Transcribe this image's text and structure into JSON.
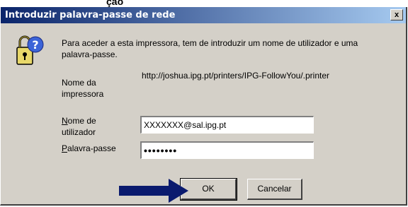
{
  "top_fragment": "ção",
  "window": {
    "title": "Introduzir palavra-passe de rede",
    "close_glyph": "x"
  },
  "message": "Para aceder a esta impressora, tem de introduzir um nome de utilizador e uma palavra-passe.",
  "printer": {
    "label": "Nome da impressora",
    "value": "http://joshua.ipg.pt/printers/IPG-FollowYou/.printer"
  },
  "username": {
    "label_accel": "N",
    "label_rest": "ome de utilizador",
    "value": "XXXXXXX@sal.ipg.pt"
  },
  "password": {
    "label_accel": "P",
    "label_rest": "alavra-passe",
    "value": "••••••••"
  },
  "buttons": {
    "ok": "OK",
    "cancel": "Cancelar"
  },
  "colors": {
    "title_gradient_start": "#0a246a",
    "title_gradient_end": "#a6caf0",
    "dialog_face": "#d4d0c8",
    "arrow": "#0a1a6e"
  },
  "icons": {
    "dialog": "key-question-icon",
    "pointer": "right-arrow-icon"
  }
}
